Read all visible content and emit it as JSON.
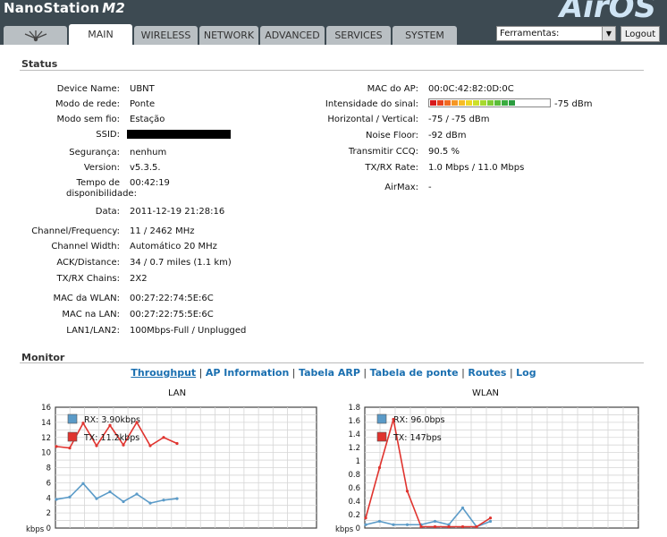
{
  "header": {
    "brand": "NanoStation",
    "model": "M2",
    "os_logo": "AirOS"
  },
  "tabs": [
    {
      "label": "MAIN",
      "active": true
    },
    {
      "label": "WIRELESS"
    },
    {
      "label": "NETWORK"
    },
    {
      "label": "ADVANCED"
    },
    {
      "label": "SERVICES"
    },
    {
      "label": "SYSTEM"
    }
  ],
  "tools": {
    "selected": "Ferramentas:",
    "logout_label": "Logout"
  },
  "status": {
    "title": "Status",
    "left": [
      {
        "label": "Device Name:",
        "value": "UBNT"
      },
      {
        "label": "Modo de rede:",
        "value": "Ponte"
      },
      {
        "label": "Modo sem fio:",
        "value": "Estação"
      },
      {
        "label": "SSID:",
        "value": ""
      },
      {
        "label": "Segurança:",
        "value": "nenhum"
      },
      {
        "label": "Version:",
        "value": "v5.3.5."
      },
      {
        "label": "Tempo de disponibilidade:",
        "value": "00:42:19"
      },
      {
        "label": "Data:",
        "value": "2011-12-19 21:28:16"
      },
      {
        "label": "Channel/Frequency:",
        "value": "11 / 2462 MHz"
      },
      {
        "label": "Channel Width:",
        "value": "Automático 20 MHz"
      },
      {
        "label": "ACK/Distance:",
        "value": "34 / 0.7 miles (1.1 km)"
      },
      {
        "label": "TX/RX Chains:",
        "value": "2X2"
      },
      {
        "label": "MAC da WLAN:",
        "value": "00:27:22:74:5E:6C"
      },
      {
        "label": "MAC na LAN:",
        "value": "00:27:22:75:5E:6C"
      },
      {
        "label": "LAN1/LAN2:",
        "value": "100Mbps-Full / Unplugged"
      }
    ],
    "right": [
      {
        "label": "MAC do AP:",
        "value": "00:0C:42:82:0D:0C"
      },
      {
        "label": "Intensidade do sinal:",
        "value": "-75 dBm"
      },
      {
        "label": "Horizontal / Vertical:",
        "value": "-75 / -75 dBm"
      },
      {
        "label": "Noise Floor:",
        "value": "-92 dBm"
      },
      {
        "label": "Transmitir CCQ:",
        "value": "90.5 %"
      },
      {
        "label": "TX/RX Rate:",
        "value": "1.0 Mbps / 11.0 Mbps"
      },
      {
        "label": "AirMax:",
        "value": "-"
      }
    ],
    "signal_level": 0.47,
    "signal_colors": [
      "#d7191c",
      "#e8421e",
      "#f06a22",
      "#f59624",
      "#f7bc26",
      "#eed626",
      "#cde02a",
      "#a6d92f",
      "#7fcc35",
      "#5bbd3a",
      "#3aac3f",
      "#2a9c3f"
    ]
  },
  "monitor": {
    "title": "Monitor",
    "links": [
      "Throughput",
      "AP Information",
      "Tabela ARP",
      "Tabela de ponte",
      "Routes",
      "Log"
    ]
  },
  "chart_data": [
    {
      "type": "line",
      "title": "LAN",
      "ylabel": "kbps",
      "ylim": [
        0,
        16
      ],
      "yticks": [
        "16",
        "14",
        "12",
        "10",
        "8",
        "6",
        "4",
        "2",
        "0"
      ],
      "series": [
        {
          "name": "RX: 3.90kbps",
          "color": "#5b9bc8",
          "values": [
            3.8,
            4.1,
            5.9,
            3.9,
            4.8,
            3.5,
            4.5,
            3.3,
            3.7,
            3.9
          ]
        },
        {
          "name": "TX: 11.2kbps",
          "color": "#e0332e",
          "values": [
            10.8,
            10.6,
            13.9,
            10.9,
            13.6,
            11.0,
            14.0,
            10.9,
            12.0,
            11.2
          ]
        }
      ]
    },
    {
      "type": "line",
      "title": "WLAN",
      "ylabel": "kbps",
      "ylim": [
        0,
        1.8
      ],
      "yticks": [
        "1.8",
        "1.6",
        "1.4",
        "1.2",
        "1",
        "0.8",
        "0.6",
        "0.4",
        "0.2",
        "0"
      ],
      "series": [
        {
          "name": "RX: 96.0bps",
          "color": "#5b9bc8",
          "values": [
            0.05,
            0.1,
            0.05,
            0.05,
            0.05,
            0.1,
            0.05,
            0.3,
            0.02,
            0.1
          ]
        },
        {
          "name": "TX: 147bps",
          "color": "#e0332e",
          "values": [
            0.15,
            0.9,
            1.62,
            0.55,
            0.02,
            0.02,
            0.02,
            0.02,
            0.02,
            0.15
          ]
        }
      ]
    }
  ]
}
